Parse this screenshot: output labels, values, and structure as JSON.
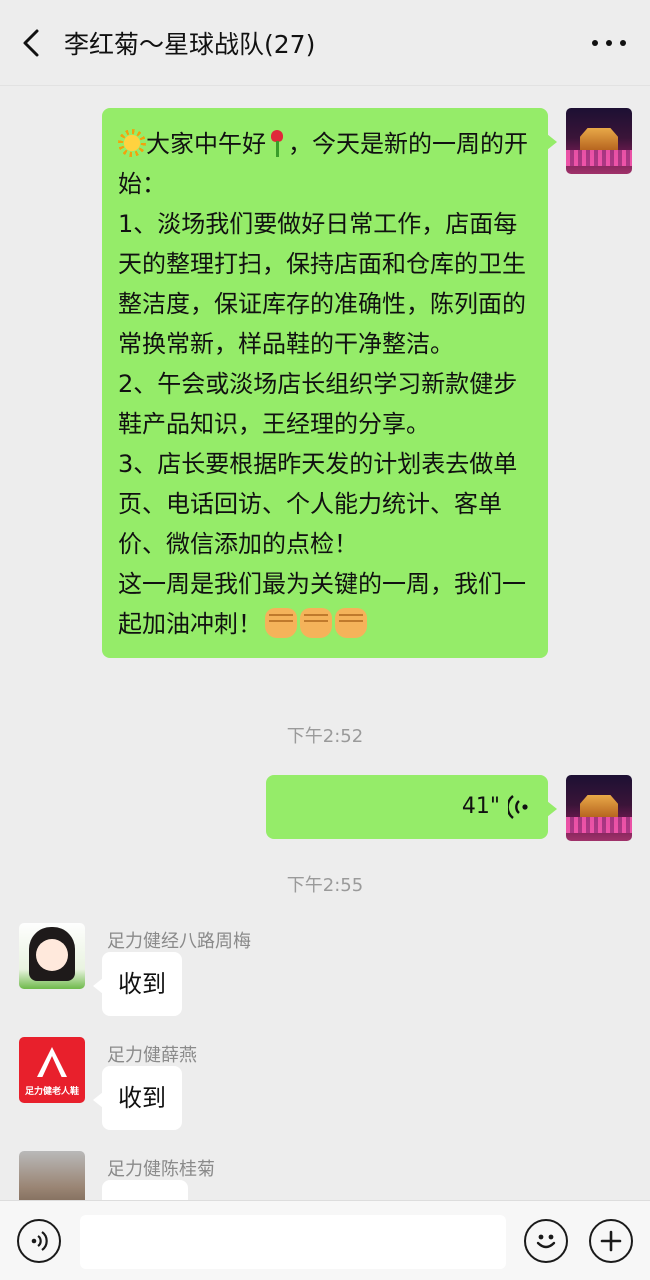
{
  "header": {
    "title": "李红菊～星球战队(27)"
  },
  "messages": {
    "m1": {
      "line1_a": "大家中午好",
      "line1_b": "，今天是新的一周的开始：",
      "p1": "1、淡场我们要做好日常工作，店面每天的整理打扫，保持店面和仓库的卫生整洁度，保证库存的准确性，陈列面的常换常新，样品鞋的干净整洁。",
      "p2": "2、午会或淡场店长组织学习新款健步鞋产品知识，王经理的分享。",
      "p3": "3、店长要根据昨天发的计划表去做单页、电话回访、个人能力统计、客单价、微信添加的点检！",
      "p4": "这一周是我们最为关键的一周，我们一起加油冲刺！"
    },
    "time1": "下午2:52",
    "voice": {
      "duration": "41\""
    },
    "time2": "下午2:55",
    "r1": {
      "sender": "足力健经八路周梅",
      "text": "收到"
    },
    "r2": {
      "sender": "足力健薛燕",
      "text": "收到",
      "avatar_text": "足力健老人鞋"
    },
    "r3": {
      "sender": "足力健陈桂菊"
    }
  },
  "icons": {
    "back": "chevron-left-icon",
    "more": "more-dots-icon",
    "voice_toggle": "voice-icon",
    "emoji": "emoji-icon",
    "plus": "plus-icon"
  },
  "colors": {
    "sent_bubble": "#95ec69",
    "received_bubble": "#ffffff",
    "background": "#ededed"
  }
}
